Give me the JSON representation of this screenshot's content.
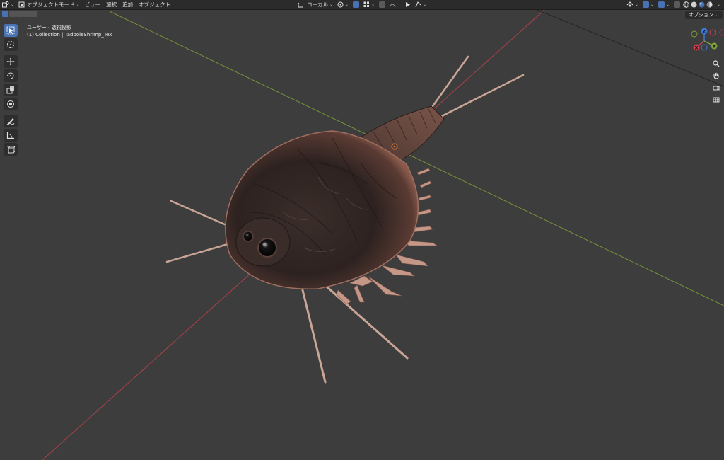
{
  "header": {
    "mode_label": "オブジェクトモード",
    "menus": [
      "ビュー",
      "選択",
      "追加",
      "オブジェクト"
    ],
    "transform_space": "ローカル"
  },
  "viewport": {
    "view_label": "ユーザー・透視投影",
    "collection_label": "(1) Collection | TadpoleShrimp_Tex",
    "options_label": "オプション"
  },
  "gizmo": {
    "z_label": "Z",
    "y_label": "Y",
    "x_label": "X"
  },
  "colors": {
    "x_axis": "#c8434f",
    "y_axis": "#7fa33a",
    "z_axis": "#3b7ad8",
    "active_tool": "#4772b3",
    "background": "#3d3d3d"
  },
  "icons": {
    "toolbar": [
      "select-box-icon",
      "cursor-icon",
      "move-icon",
      "rotate-icon",
      "scale-icon",
      "transform-icon",
      "annotate-icon",
      "measure-icon",
      "add-cube-icon"
    ],
    "nav": [
      "zoom-icon",
      "hand-icon",
      "camera-icon",
      "grid-icon"
    ]
  }
}
